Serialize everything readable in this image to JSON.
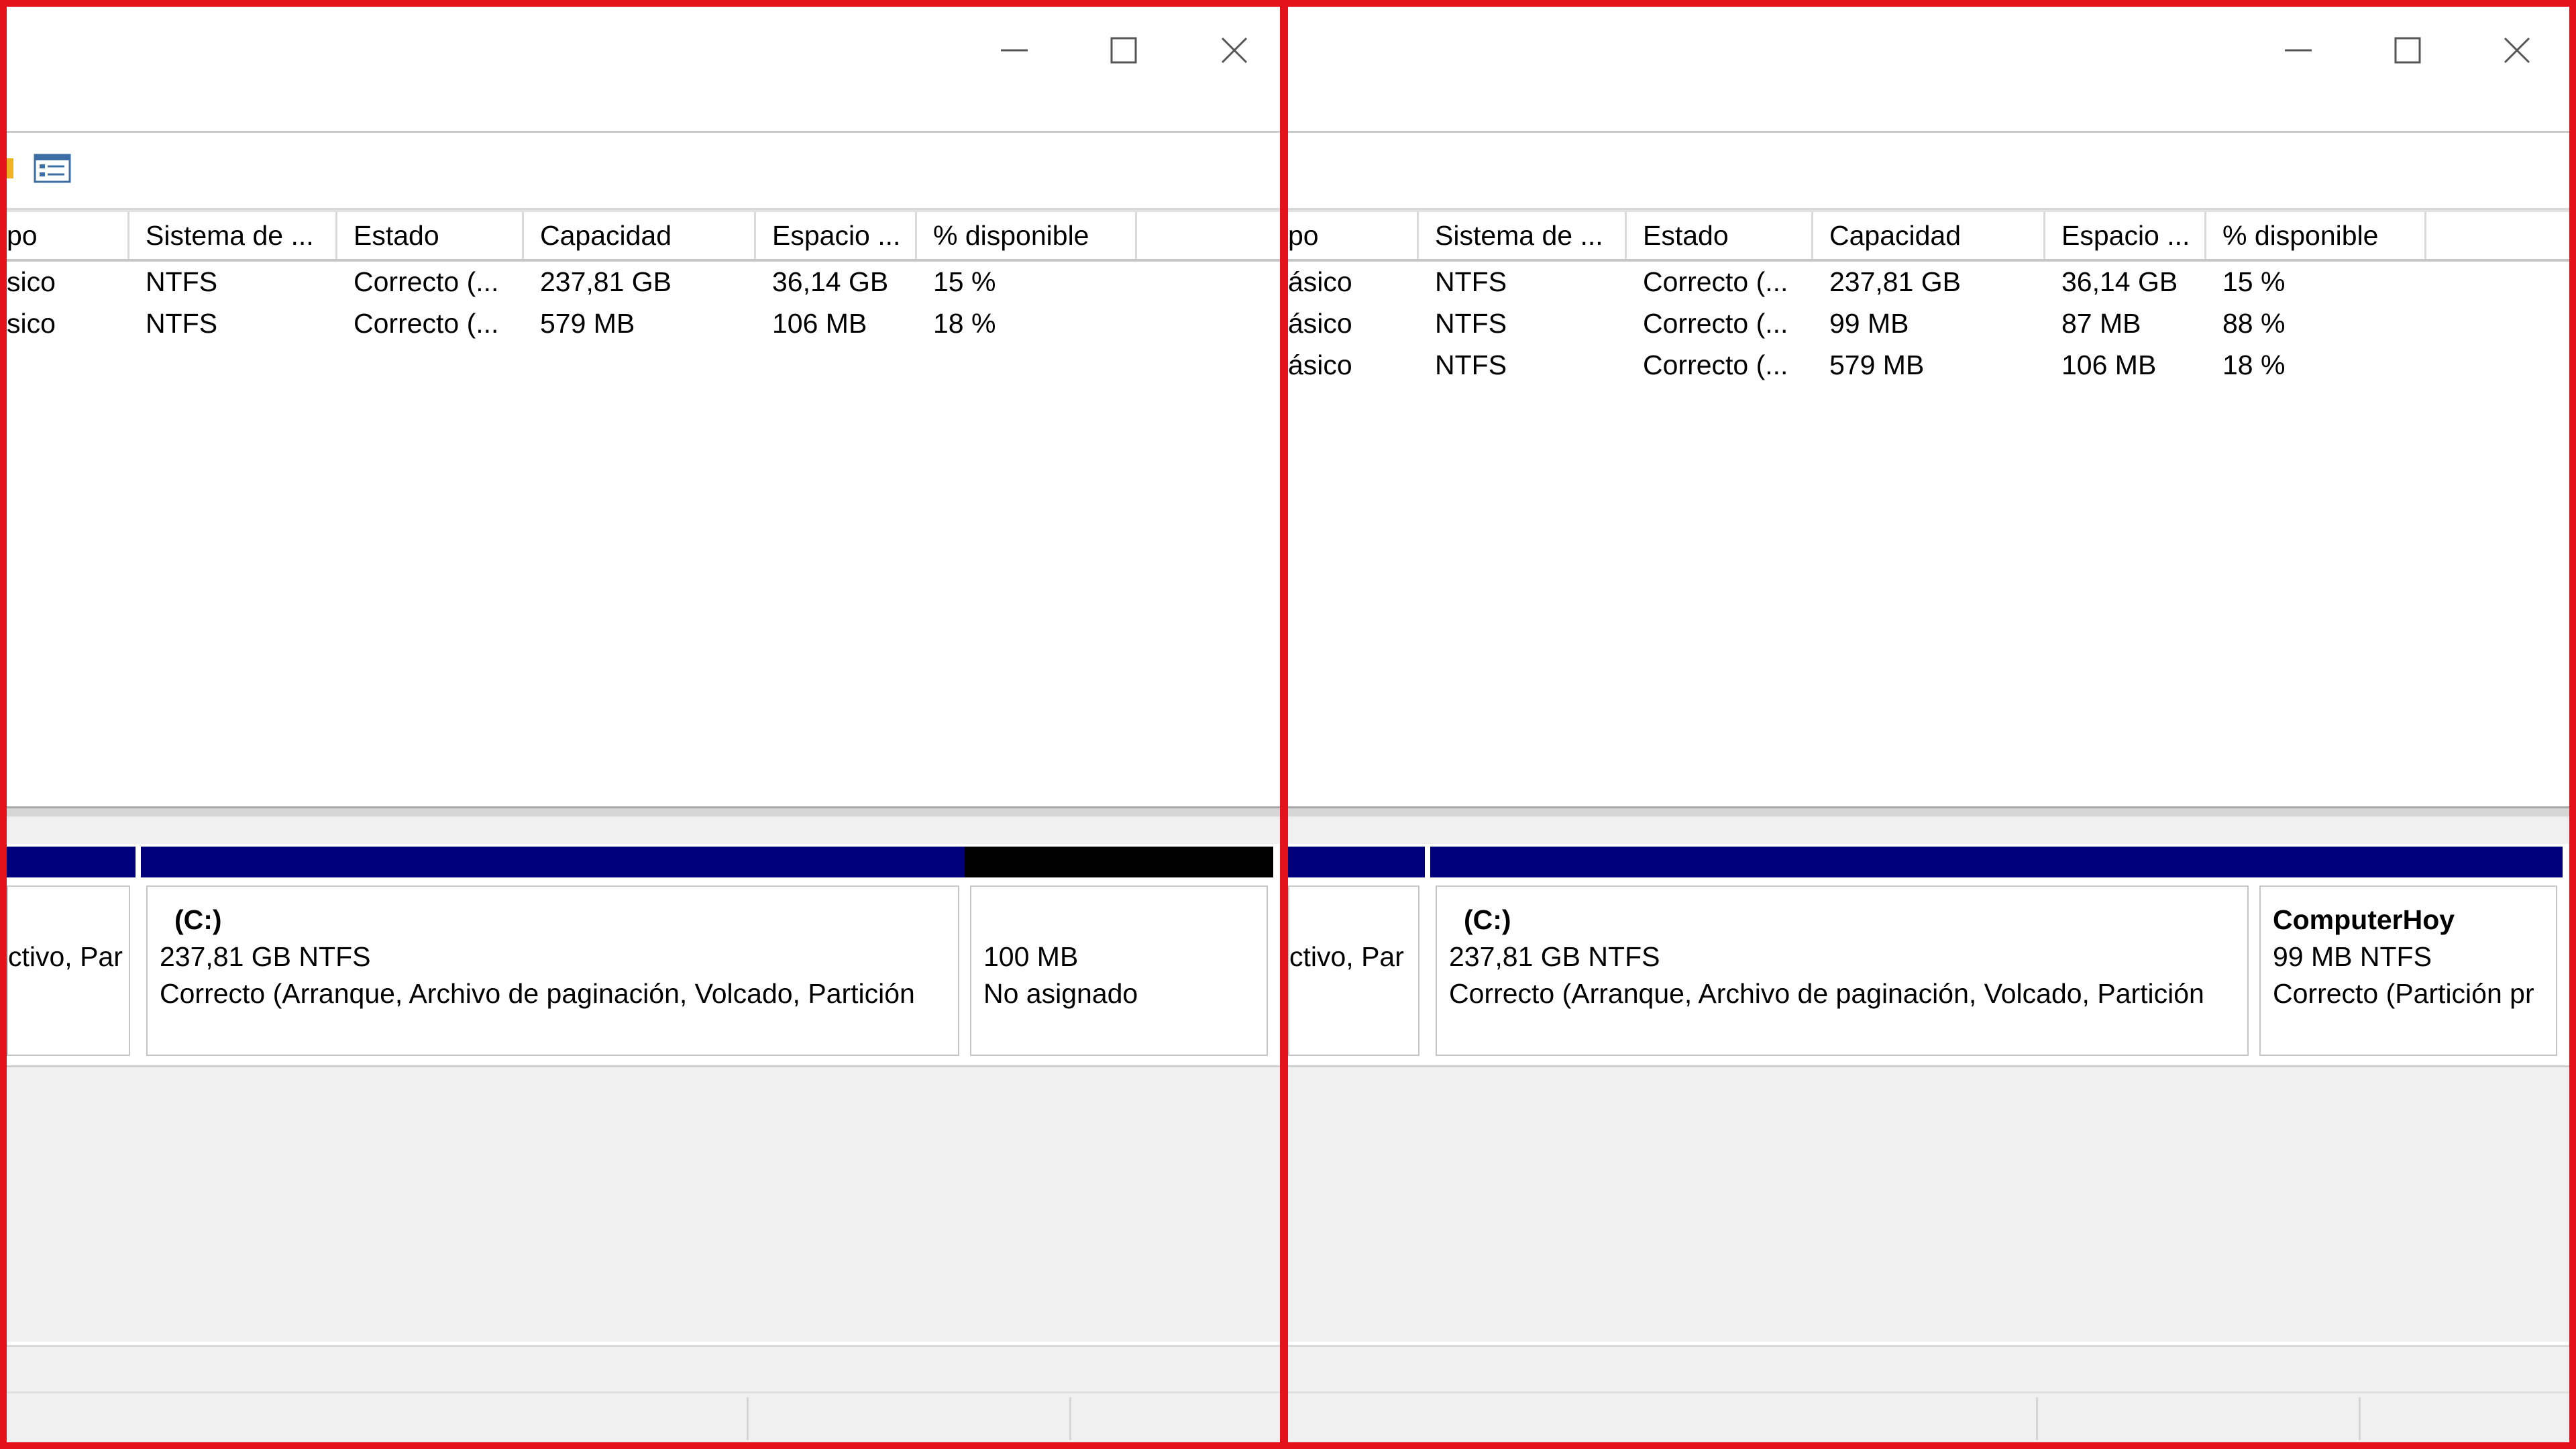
{
  "left_window": {
    "columns": [
      "po",
      "Sistema de ...",
      "Estado",
      "Capacidad",
      "Espacio ...",
      "% disponible"
    ],
    "rows": [
      [
        "sico",
        "NTFS",
        "Correcto (...",
        "237,81 GB",
        "36,14 GB",
        "15 %"
      ],
      [
        "sico",
        "NTFS",
        "Correcto (...",
        "579 MB",
        "106 MB",
        "18 %"
      ]
    ],
    "partitions": {
      "first": {
        "status": "ctivo, Par"
      },
      "c": {
        "name": "(C:)",
        "size": "237,81 GB NTFS",
        "status": "Correcto (Arranque, Archivo de paginación, Volcado, Partición"
      },
      "unallocated": {
        "size": "100 MB",
        "status": "No asignado"
      }
    }
  },
  "right_window": {
    "columns": [
      "po",
      "Sistema de ...",
      "Estado",
      "Capacidad",
      "Espacio ...",
      "% disponible"
    ],
    "rows": [
      [
        "ásico",
        "NTFS",
        "Correcto (...",
        "237,81 GB",
        "36,14 GB",
        "15 %"
      ],
      [
        "ásico",
        "NTFS",
        "Correcto (...",
        "99 MB",
        "87 MB",
        "88 %"
      ],
      [
        "ásico",
        "NTFS",
        "Correcto (...",
        "579 MB",
        "106 MB",
        "18 %"
      ]
    ],
    "partitions": {
      "first": {
        "status": "ctivo, Par"
      },
      "c": {
        "name": "(C:)",
        "size": "237,81 GB NTFS",
        "status": "Correcto (Arranque, Archivo de paginación, Volcado, Partición"
      },
      "computerhoy": {
        "name": "ComputerHoy",
        "size": "99 MB NTFS",
        "status": "Correcto (Partición pr"
      }
    }
  },
  "colors": {
    "frame": "#e3121b",
    "partition_bar": "#00007a",
    "unallocated_bar": "#000000"
  },
  "icons": [
    "minimize-icon",
    "maximize-icon",
    "close-icon",
    "properties-icon"
  ]
}
